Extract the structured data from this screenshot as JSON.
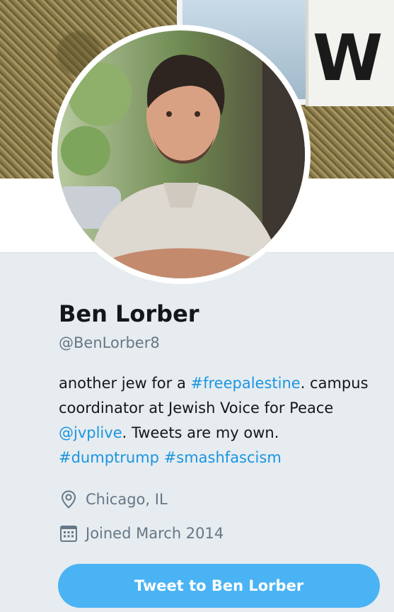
{
  "profile": {
    "name": "Ben Lorber",
    "handle": "@BenLorber8",
    "bio": {
      "part1": "another jew for a ",
      "hashtag1": "#freepalestine",
      "part2": ". campus coordinator at Jewish Voice for Peace ",
      "mention": "@jvplive",
      "part3": ". Tweets are my own. ",
      "hashtag2": "#dumptrump",
      "space": " ",
      "hashtag3": "#smashfascism"
    },
    "location": "Chicago, IL",
    "joined": "Joined March 2014"
  },
  "actions": {
    "tweet_to_label": "Tweet to Ben Lorber"
  },
  "icons": {
    "location": "location-pin-icon",
    "calendar": "calendar-icon"
  },
  "colors": {
    "link": "#1b95e0",
    "button": "#4ab3f4",
    "secondary_text": "#657786",
    "background": "#e6ecf0"
  }
}
